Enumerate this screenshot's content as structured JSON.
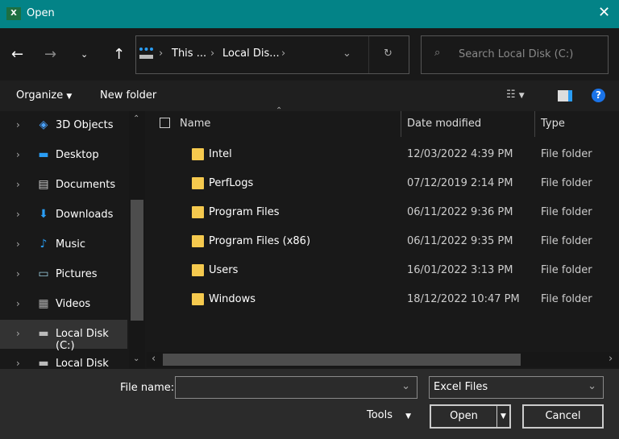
{
  "window": {
    "title": "Open",
    "app_icon": "excel-icon",
    "close": "✕",
    "accent": "#038387"
  },
  "nav": {
    "address": {
      "crumbs": [
        "This ...",
        "Local Dis..."
      ]
    },
    "search_placeholder": "Search Local Disk (C:)"
  },
  "toolbar": {
    "organize": "Organize",
    "new_folder": "New folder"
  },
  "sidebar": {
    "items": [
      {
        "label": "3D Objects",
        "icon": "3d-objects-icon"
      },
      {
        "label": "Desktop",
        "icon": "desktop-icon"
      },
      {
        "label": "Documents",
        "icon": "documents-icon"
      },
      {
        "label": "Downloads",
        "icon": "downloads-icon"
      },
      {
        "label": "Music",
        "icon": "music-icon"
      },
      {
        "label": "Pictures",
        "icon": "pictures-icon"
      },
      {
        "label": "Videos",
        "icon": "videos-icon"
      },
      {
        "label": "Local Disk (C:)",
        "icon": "drive-icon",
        "selected": true
      },
      {
        "label": "Local Disk (D:)",
        "icon": "drive-icon"
      }
    ]
  },
  "files": {
    "columns": [
      "Name",
      "Date modified",
      "Type"
    ],
    "rows": [
      {
        "name": "Intel",
        "date": "12/03/2022 4:39 PM",
        "type": "File folder"
      },
      {
        "name": "PerfLogs",
        "date": "07/12/2019 2:14 PM",
        "type": "File folder"
      },
      {
        "name": "Program Files",
        "date": "06/11/2022 9:36 PM",
        "type": "File folder"
      },
      {
        "name": "Program Files (x86)",
        "date": "06/11/2022 9:35 PM",
        "type": "File folder"
      },
      {
        "name": "Users",
        "date": "16/01/2022 3:13 PM",
        "type": "File folder"
      },
      {
        "name": "Windows",
        "date": "18/12/2022 10:47 PM",
        "type": "File folder"
      }
    ]
  },
  "bottom": {
    "file_name_label": "File name:",
    "file_name_value": "",
    "file_type": "Excel Files",
    "tools": "Tools",
    "open": "Open",
    "cancel": "Cancel"
  }
}
